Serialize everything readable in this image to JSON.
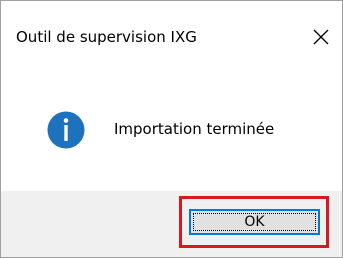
{
  "dialog": {
    "title": "Outil de supervision IXG",
    "close_icon": "close-icon",
    "message_icon": "info-icon",
    "message": "Importation terminée",
    "ok_label": "OK",
    "colors": {
      "info_icon": "#1e72bd",
      "highlight": "#d71920",
      "button_focus": "#0078d7",
      "footer": "#f0f0f0"
    }
  }
}
